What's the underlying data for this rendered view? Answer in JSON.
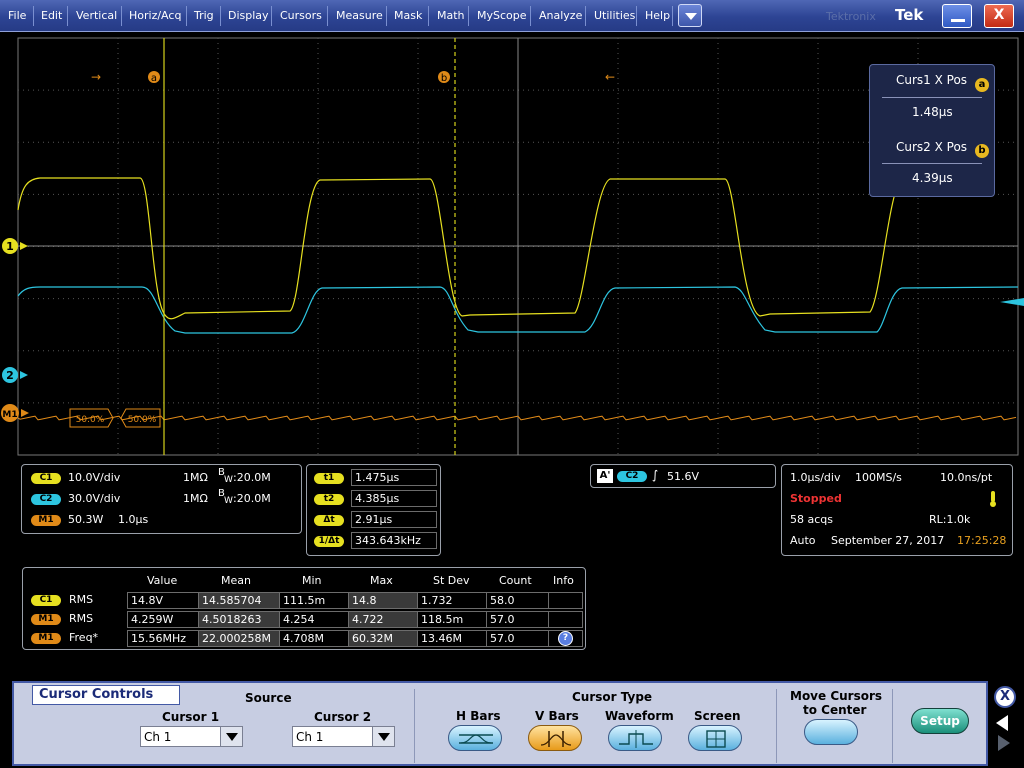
{
  "menu": {
    "items": [
      "File",
      "Edit",
      "Vertical",
      "Horiz/Acq",
      "Trig",
      "Display",
      "Cursors",
      "Measure",
      "Mask",
      "Math",
      "MyScope",
      "Analyze",
      "Utilities",
      "Help"
    ],
    "brand": "Tek",
    "ghost_text": "Tektronix"
  },
  "colors": {
    "ch1": "#e6e020",
    "ch2": "#2dc5e0",
    "m1": "#e08a18",
    "grid": "#555555",
    "menu": "#2d4494"
  },
  "scope": {
    "cursor_a_label": "a",
    "cursor_b_label": "b",
    "ch1_marker": "1",
    "ch2_marker": "2",
    "m1_marker": "M1",
    "m1_label_left": "50.0%",
    "m1_label_right": "50.0%",
    "cursor_popup": {
      "curs1_label": "Curs1 X Pos",
      "curs1_value": "1.48µs",
      "curs2_label": "Curs2 X Pos",
      "curs2_value": "4.39µs"
    }
  },
  "channels": {
    "c1": {
      "tag": "C1",
      "scale": "10.0V/div",
      "imp": "1MΩ",
      "bw_b": "B",
      "bw_w": "W",
      "bw": ":20.0M"
    },
    "c2": {
      "tag": "C2",
      "scale": "30.0V/div",
      "imp": "1MΩ",
      "bw_b": "B",
      "bw_w": "W",
      "bw": ":20.0M"
    },
    "m1": {
      "tag": "M1",
      "scale": "50.3W",
      "time": "1.0µs"
    }
  },
  "cursor_readout": {
    "t1_label": "t1",
    "t1": "1.475µs",
    "t2_label": "t2",
    "t2": "4.385µs",
    "dt_label": "Δt",
    "dt": "2.91µs",
    "inv_label": "1/Δt",
    "inv": "343.643kHz"
  },
  "trigger": {
    "a": "A'",
    "src": "C2",
    "slope": "∫",
    "level": "51.6V"
  },
  "acq": {
    "hscale": "1.0µs/div",
    "rate": "100MS/s",
    "res": "10.0ns/pt",
    "state": "Stopped",
    "acqs": "58 acqs",
    "rl": "RL:1.0k",
    "mode": "Auto",
    "date": "September 27, 2017",
    "time": "17:25:28"
  },
  "measurements": {
    "headers": [
      "Value",
      "Mean",
      "Min",
      "Max",
      "St Dev",
      "Count",
      "Info"
    ],
    "rows": [
      {
        "tag": "C1",
        "name": "RMS",
        "cells": [
          "14.8V",
          "14.585704",
          "111.5m",
          "14.8",
          "1.732",
          "58.0"
        ]
      },
      {
        "tag": "M1",
        "name": "RMS",
        "cells": [
          "4.259W",
          "4.5018263",
          "4.254",
          "4.722",
          "118.5m",
          "57.0"
        ]
      },
      {
        "tag": "M1",
        "name": "Freq*",
        "cells": [
          "15.56MHz",
          "22.000258M",
          "4.708M",
          "60.32M",
          "13.46M",
          "57.0"
        ]
      }
    ],
    "info_icon": "?"
  },
  "cursor_controls": {
    "tab": "Cursor Controls",
    "source_label": "Source",
    "cursor1_label": "Cursor 1",
    "cursor2_label": "Cursor 2",
    "cursor1_value": "Ch 1",
    "cursor2_value": "Ch 1",
    "type_label": "Cursor Type",
    "types": [
      "H Bars",
      "V Bars",
      "Waveform",
      "Screen"
    ],
    "selected_type": "V Bars",
    "move_label_1": "Move Cursors",
    "move_label_2": "to Center",
    "setup": "Setup",
    "close": "X"
  }
}
